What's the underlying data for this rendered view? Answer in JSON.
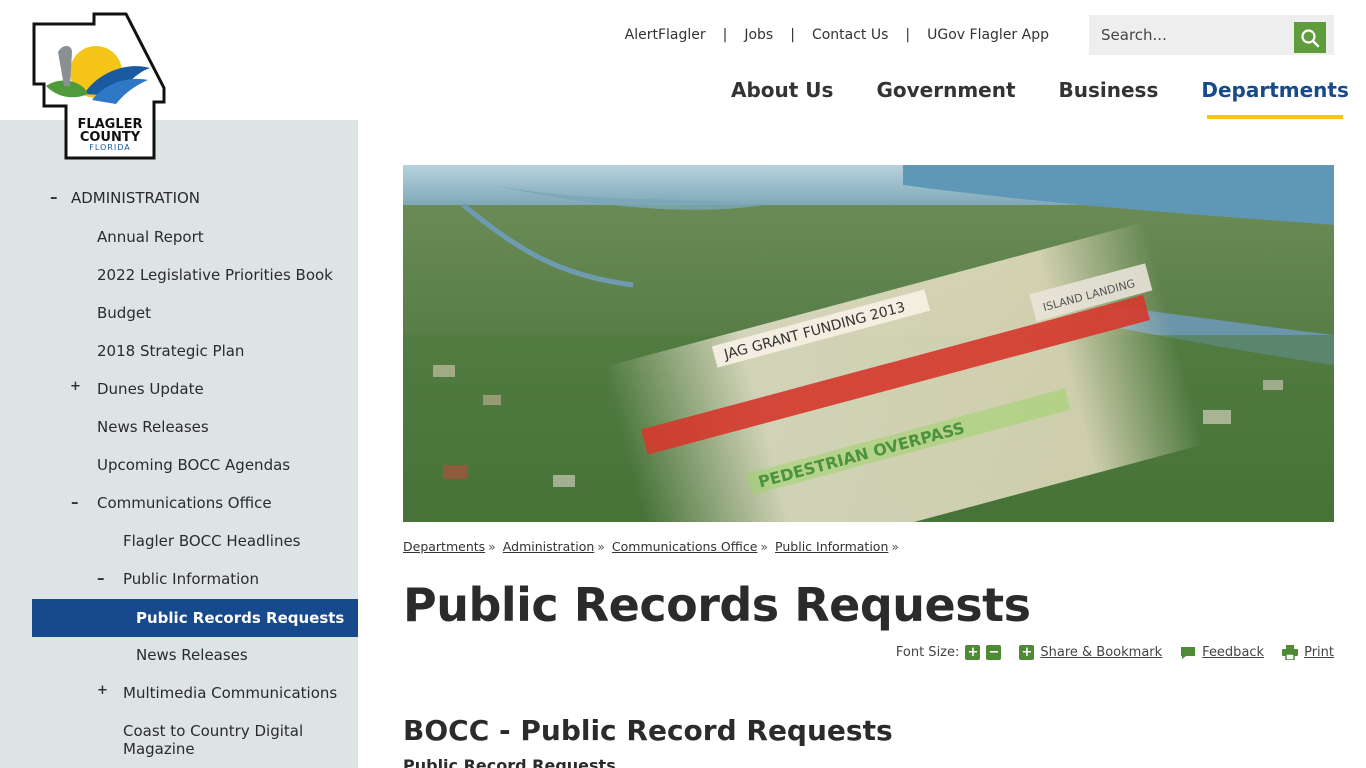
{
  "logo": {
    "line1": "FLAGLER",
    "line2": "COUNTY",
    "line3": "FLORIDA"
  },
  "utility_links": [
    "AlertFlagler",
    "Jobs",
    "Contact Us",
    "UGov Flagler App"
  ],
  "search": {
    "placeholder": "Search..."
  },
  "main_nav": [
    "About Us",
    "Government",
    "Business",
    "Departments"
  ],
  "sidebar": {
    "items": [
      {
        "label": "ADMINISTRATION",
        "toggle": "–"
      },
      {
        "label": "Annual Report",
        "toggle": ""
      },
      {
        "label": "2022 Legislative Priorities Book",
        "toggle": ""
      },
      {
        "label": "Budget",
        "toggle": ""
      },
      {
        "label": "2018 Strategic Plan",
        "toggle": ""
      },
      {
        "label": "Dunes Update",
        "toggle": "+"
      },
      {
        "label": "News Releases",
        "toggle": ""
      },
      {
        "label": "Upcoming BOCC Agendas",
        "toggle": ""
      },
      {
        "label": "Communications Office",
        "toggle": "–"
      },
      {
        "label": "Flagler BOCC Headlines",
        "toggle": ""
      },
      {
        "label": "Public Information",
        "toggle": "–"
      },
      {
        "label": "Public Records Requests",
        "toggle": ""
      },
      {
        "label": "News Releases",
        "toggle": ""
      },
      {
        "label": "Multimedia Communications",
        "toggle": "+"
      },
      {
        "label": "Coast to Country Digital",
        "label2": "Magazine",
        "toggle": ""
      }
    ]
  },
  "hero": {
    "folder_label_1": "JAG GRANT FUNDING 2013",
    "folder_label_2": "PEDESTRIAN OVERPASS",
    "folder_label_3": "ISLAND LANDING"
  },
  "breadcrumb": [
    "Departments",
    "Administration",
    "Communications Office",
    "Public Information"
  ],
  "breadcrumb_sep": "»",
  "page_title": "Public Records Requests",
  "tools": {
    "font_size_label": "Font Size:",
    "share": "Share & Bookmark",
    "feedback": "Feedback",
    "print": "Print"
  },
  "content": {
    "heading": "BOCC - Public Record Requests",
    "subheading": "Public Record Requests"
  },
  "colors": {
    "active_nav": "#174a8c",
    "accent_yellow": "#f5c518",
    "accent_green": "#5e9c3c",
    "sidebar_bg": "#dde4e6"
  }
}
